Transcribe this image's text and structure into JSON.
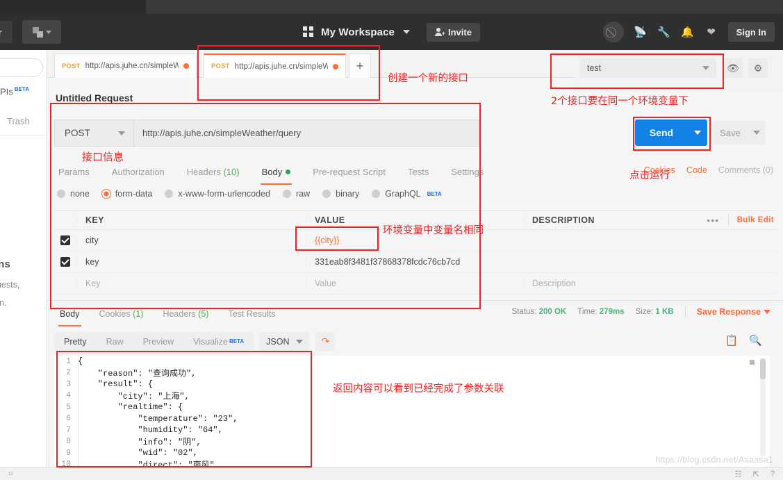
{
  "topbar": {
    "workspace": "My Workspace",
    "invite": "Invite",
    "signin": "Sign In",
    "icons": [
      "interceptor-icon",
      "satellite-icon",
      "wrench-icon",
      "bell-icon",
      "heart-icon"
    ]
  },
  "sidebar": {
    "apis_label": "PIs",
    "apis_beta": "BETA",
    "trash": "Trash",
    "frag_title": "ons",
    "frag_line1": "quests,",
    "frag_line2": "run."
  },
  "tabs": [
    {
      "method": "POST",
      "url": "http://apis.juhe.cn/simpleWea...",
      "unsaved": true,
      "active": false
    },
    {
      "method": "POST",
      "url": "http://apis.juhe.cn/simpleWea...",
      "unsaved": true,
      "active": true
    }
  ],
  "new_tab_label": "+",
  "environment": {
    "selected": "test",
    "eye_icon": "eye-icon",
    "gear_icon": "gear-icon"
  },
  "request": {
    "name": "Untitled Request",
    "method": "POST",
    "url": "http://apis.juhe.cn/simpleWeather/query",
    "send_label": "Send",
    "save_label": "Save",
    "tabs": [
      {
        "label": "Params",
        "active": false
      },
      {
        "label": "Authorization",
        "active": false
      },
      {
        "label": "Headers",
        "count": "(10)",
        "active": false
      },
      {
        "label": "Body",
        "active": true,
        "dot": true
      },
      {
        "label": "Pre-request Script",
        "active": false
      },
      {
        "label": "Tests",
        "active": false
      },
      {
        "label": "Settings",
        "active": false
      }
    ],
    "links": [
      {
        "label": "Cookies",
        "muted": false
      },
      {
        "label": "Code",
        "muted": false
      },
      {
        "label": "Comments (0)",
        "muted": true
      }
    ],
    "body_types": [
      {
        "label": "none",
        "selected": false
      },
      {
        "label": "form-data",
        "selected": true
      },
      {
        "label": "x-www-form-urlencoded",
        "selected": false
      },
      {
        "label": "raw",
        "selected": false
      },
      {
        "label": "binary",
        "selected": false
      },
      {
        "label": "GraphQL",
        "selected": false,
        "beta": "BETA"
      }
    ],
    "table": {
      "headers": {
        "key": "KEY",
        "value": "VALUE",
        "description": "DESCRIPTION"
      },
      "bulk_edit": "Bulk Edit",
      "more": "•••",
      "rows": [
        {
          "checked": true,
          "key": "city",
          "value": "{{city}}",
          "value_is_variable": true,
          "description": ""
        },
        {
          "checked": true,
          "key": "key",
          "value": "331eab8f3481f37868378fcdc76cb7cd",
          "value_is_variable": false,
          "description": ""
        },
        {
          "checked": false,
          "key": "Key",
          "value": "Value",
          "description": "Description",
          "placeholder": true
        }
      ]
    }
  },
  "response": {
    "tabs": [
      {
        "label": "Body",
        "active": true
      },
      {
        "label": "Cookies",
        "count": "(1)",
        "active": false
      },
      {
        "label": "Headers",
        "count": "(5)",
        "active": false
      },
      {
        "label": "Test Results",
        "active": false
      }
    ],
    "status_label": "Status:",
    "status_value": "200 OK",
    "time_label": "Time:",
    "time_value": "279ms",
    "size_label": "Size:",
    "size_value": "1 KB",
    "save_response": "Save Response",
    "viewer_tabs": [
      {
        "label": "Pretty",
        "active": true
      },
      {
        "label": "Raw",
        "active": false
      },
      {
        "label": "Preview",
        "active": false
      },
      {
        "label": "Visualize",
        "active": false,
        "beta": "BETA"
      }
    ],
    "format": "JSON",
    "copy_icon": "copy-icon",
    "search_icon": "search-icon",
    "wrap_icon": "wrap-lines-icon",
    "code_lines": [
      {
        "n": "1",
        "text": "{"
      },
      {
        "n": "2",
        "text": "    \"reason\": \"查询成功\","
      },
      {
        "n": "3",
        "text": "    \"result\": {"
      },
      {
        "n": "4",
        "text": "        \"city\": \"上海\","
      },
      {
        "n": "5",
        "text": "        \"realtime\": {"
      },
      {
        "n": "6",
        "text": "            \"temperature\": \"23\","
      },
      {
        "n": "7",
        "text": "            \"humidity\": \"64\","
      },
      {
        "n": "8",
        "text": "            \"info\": \"阴\","
      },
      {
        "n": "9",
        "text": "            \"wid\": \"02\","
      },
      {
        "n": "10",
        "text": "            \"direct\": \"南风\","
      }
    ]
  },
  "annotations": [
    {
      "id": "create-new-api",
      "text": "创建一个新的接口"
    },
    {
      "id": "same-environment",
      "text": "2个接口要在同一个环境变量下"
    },
    {
      "id": "api-info",
      "text": "接口信息"
    },
    {
      "id": "click-run",
      "text": "点击运行"
    },
    {
      "id": "same-var-name",
      "text": "环境变量中变量名相同"
    },
    {
      "id": "param-linked",
      "text": "返回内容可以看到已经完成了参数关联"
    }
  ],
  "watermark": "https://blog.csdn.net/Asaasa1",
  "colors": {
    "accent_orange": "#ff6c37",
    "send_blue": "#1282e6",
    "annotation_red": "#f42020",
    "status_green": "#49b47d"
  }
}
